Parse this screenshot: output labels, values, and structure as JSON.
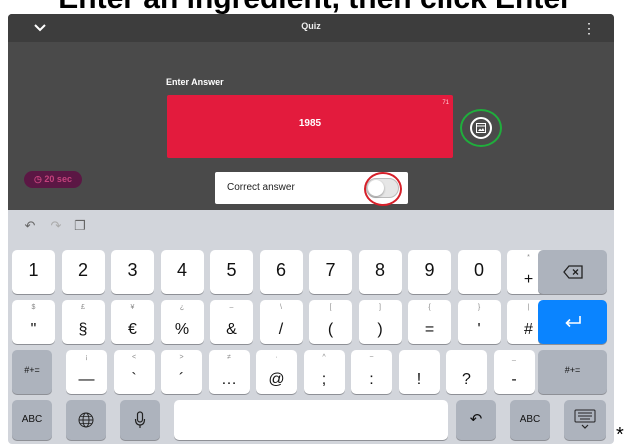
{
  "overlay_text": "Enter an ingredient, then click Enter",
  "app": {
    "title": "Quiz"
  },
  "question": {
    "label": "Enter Answer",
    "answer_value": "1985",
    "char_count": "71",
    "color": "#e31b3d"
  },
  "timer": {
    "label": "20 sec"
  },
  "correct_answer": {
    "label": "Correct answer",
    "toggle_on": false
  },
  "keyboard": {
    "row1": [
      {
        "main": "1"
      },
      {
        "main": "2"
      },
      {
        "main": "3"
      },
      {
        "main": "4"
      },
      {
        "main": "5"
      },
      {
        "main": "6"
      },
      {
        "main": "7"
      },
      {
        "main": "8"
      },
      {
        "main": "9"
      },
      {
        "main": "0"
      },
      {
        "main": "+",
        "hint": "*"
      }
    ],
    "row2": [
      {
        "main": "\"",
        "hint": "$"
      },
      {
        "main": "§",
        "hint": "£"
      },
      {
        "main": "€",
        "hint": "¥"
      },
      {
        "main": "%",
        "hint": "¿"
      },
      {
        "main": "&",
        "hint": "–"
      },
      {
        "main": "/",
        "hint": "\\"
      },
      {
        "main": "(",
        "hint": "["
      },
      {
        "main": ")",
        "hint": "]"
      },
      {
        "main": "=",
        "hint": "{"
      },
      {
        "main": "'",
        "hint": "}"
      },
      {
        "main": "#",
        "hint": "|"
      }
    ],
    "row3": [
      {
        "main": "—",
        "hint": "¡"
      },
      {
        "main": "`",
        "hint": "<"
      },
      {
        "main": "´",
        "hint": ">"
      },
      {
        "main": "…",
        "hint": "≠"
      },
      {
        "main": "@",
        "hint": "·"
      },
      {
        "main": ";",
        "hint": "^"
      },
      {
        "main": ":",
        "hint": "~"
      },
      {
        "main": "!",
        "hint": ""
      },
      {
        "main": "?",
        "hint": ""
      },
      {
        "main": "-",
        "hint": "_"
      }
    ],
    "mode_key": "#+=",
    "abc_key": "ABC",
    "trailing_mark": "*"
  }
}
